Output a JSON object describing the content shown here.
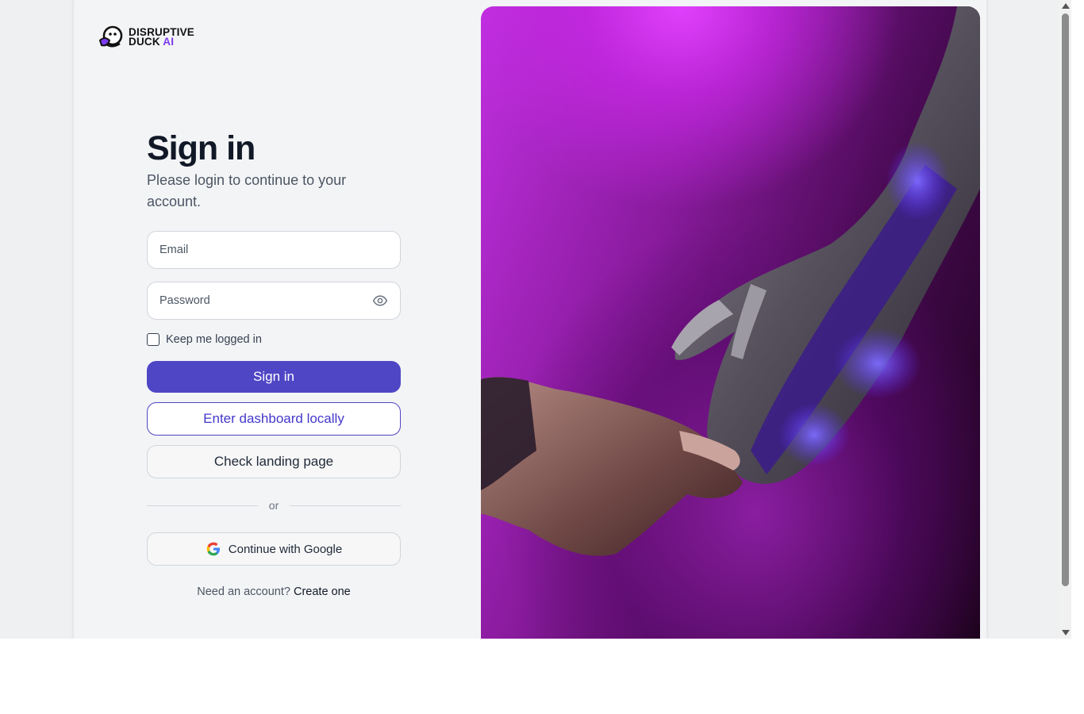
{
  "brand": {
    "name_line1": "DISRUPTIVE",
    "name_line2": "DUCK",
    "name_ai": "AI",
    "accent_color": "#7c3aed"
  },
  "signin": {
    "title": "Sign in",
    "subtitle": "Please login to continue to your account.",
    "email_placeholder": "Email",
    "password_placeholder": "Password",
    "remember_label": "Keep me logged in",
    "signin_button": "Sign in",
    "local_button": "Enter dashboard locally",
    "landing_button": "Check landing page",
    "divider_text": "or",
    "google_button": "Continue with Google",
    "signup_prompt": "Need an account?",
    "signup_link": "Create one"
  },
  "colors": {
    "primary": "#4f46c5",
    "background": "#f3f4f6"
  },
  "icons": {
    "password_toggle": "eye-icon",
    "google": "google-icon",
    "logo": "duck-logo-icon"
  }
}
